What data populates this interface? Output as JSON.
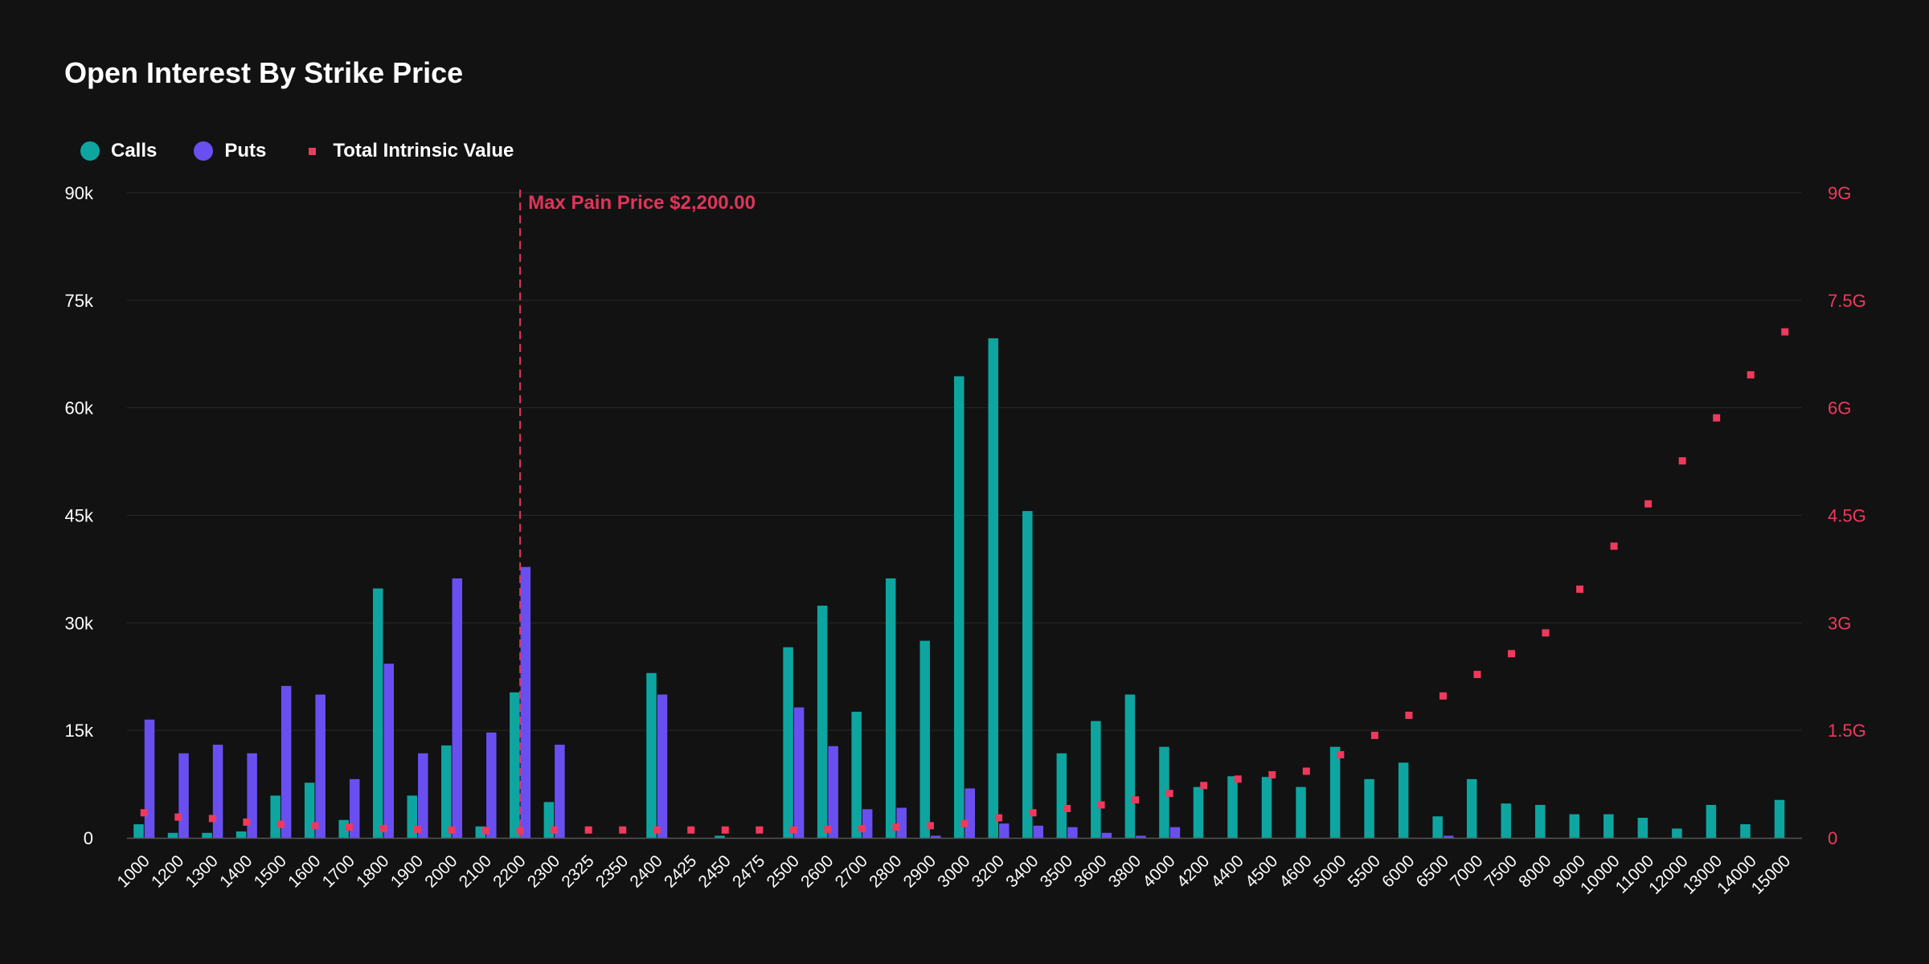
{
  "chart_data": {
    "type": "bar",
    "title": "Open Interest By Strike Price",
    "xlabel": "",
    "ylabel": "",
    "categories": [
      "1000",
      "1200",
      "1300",
      "1400",
      "1500",
      "1600",
      "1700",
      "1800",
      "1900",
      "2000",
      "2100",
      "2200",
      "2300",
      "2325",
      "2350",
      "2400",
      "2425",
      "2450",
      "2475",
      "2500",
      "2600",
      "2700",
      "2800",
      "2900",
      "3000",
      "3200",
      "3400",
      "3500",
      "3600",
      "3800",
      "4000",
      "4200",
      "4400",
      "4500",
      "4600",
      "5000",
      "5500",
      "6000",
      "6500",
      "7000",
      "7500",
      "8000",
      "9000",
      "10000",
      "11000",
      "12000",
      "13000",
      "14000",
      "15000"
    ],
    "series": [
      {
        "name": "Calls",
        "type": "bar",
        "axis": "left",
        "color": "#0ea5a0",
        "values": [
          1900,
          700,
          700,
          900,
          5900,
          7700,
          2500,
          34800,
          5900,
          12900,
          1600,
          20300,
          5000,
          0,
          0,
          23000,
          0,
          300,
          0,
          26600,
          32400,
          17600,
          36200,
          27500,
          64400,
          69700,
          45600,
          11800,
          16300,
          20000,
          12700,
          7100,
          8600,
          8500,
          7100,
          12700,
          8200,
          10500,
          3000,
          8200,
          4800,
          4600,
          3300,
          3300,
          2800,
          1300,
          4600,
          1900,
          5300
        ]
      },
      {
        "name": "Puts",
        "type": "bar",
        "axis": "left",
        "color": "#6a4ff0",
        "values": [
          16500,
          11800,
          13000,
          11800,
          21200,
          20000,
          8200,
          24300,
          11800,
          36200,
          14700,
          37800,
          13000,
          0,
          0,
          20000,
          0,
          0,
          0,
          18200,
          12800,
          4000,
          4200,
          300,
          6900,
          2000,
          1700,
          1500,
          700,
          300,
          1500,
          0,
          0,
          0,
          0,
          0,
          0,
          0,
          300,
          0,
          0,
          0,
          0,
          0,
          0,
          0,
          0,
          0,
          0
        ]
      },
      {
        "name": "Total Intrinsic Value",
        "type": "scatter",
        "axis": "right",
        "color": "#f0395c",
        "values": [
          0.35,
          0.29,
          0.27,
          0.22,
          0.19,
          0.17,
          0.15,
          0.13,
          0.12,
          0.11,
          0.1,
          0.1,
          0.11,
          0.11,
          0.11,
          0.11,
          0.11,
          0.11,
          0.11,
          0.11,
          0.12,
          0.13,
          0.15,
          0.17,
          0.2,
          0.28,
          0.35,
          0.41,
          0.46,
          0.53,
          0.62,
          0.73,
          0.82,
          0.88,
          0.93,
          1.16,
          1.43,
          1.71,
          1.98,
          2.28,
          2.57,
          2.86,
          3.47,
          4.07,
          4.66,
          5.26,
          5.86,
          6.46,
          7.06
        ]
      }
    ],
    "y_left": {
      "ylim": [
        0,
        90000
      ],
      "ticks": [
        0,
        15000,
        30000,
        45000,
        60000,
        75000,
        90000
      ],
      "tick_labels": [
        "0",
        "15k",
        "30k",
        "45k",
        "60k",
        "75k",
        "90k"
      ]
    },
    "y_right": {
      "ylim": [
        0,
        9
      ],
      "unit": "G",
      "ticks": [
        0,
        1.5,
        3,
        4.5,
        6,
        7.5,
        9
      ],
      "tick_labels": [
        "0",
        "1.5G",
        "3G",
        "4.5G",
        "6G",
        "7.5G",
        "9G"
      ]
    },
    "grid": true,
    "legend": "top-left",
    "annotation": {
      "label": "Max Pain Price $2,200.00",
      "category": "2200",
      "color": "#e0355a"
    },
    "colors": {
      "background": "#121212",
      "grid": "#2a2a2a",
      "axis_text": "#ffffff",
      "right_axis_text": "#f0395c"
    }
  },
  "legend_items": [
    {
      "label": "Calls",
      "color": "#0ea5a0",
      "shape": "circle"
    },
    {
      "label": "Puts",
      "color": "#6a4ff0",
      "shape": "circle"
    },
    {
      "label": "Total Intrinsic Value",
      "color": "#f0395c",
      "shape": "square"
    }
  ]
}
